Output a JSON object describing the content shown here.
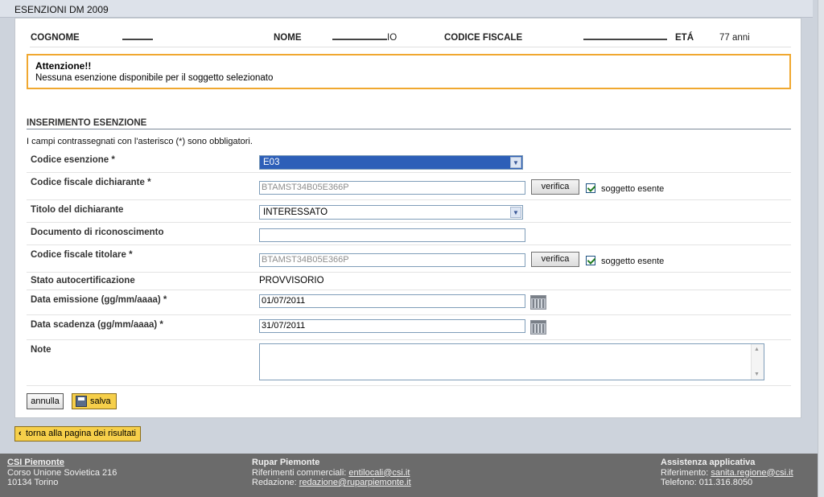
{
  "title": "ESENZIONI DM 2009",
  "patient": {
    "cognome_label": "COGNOME",
    "nome_label": "NOME",
    "nome_value_visible": "IO",
    "cf_label": "CODICE FISCALE",
    "eta_label": "ETÁ",
    "eta_value": "77 anni"
  },
  "alert": {
    "title": "Attenzione!!",
    "message": "Nessuna esenzione disponibile per il soggetto selezionato"
  },
  "section": {
    "title": "INSERIMENTO ESENZIONE",
    "required_note": "I campi contrassegnati con l'asterisco (*) sono obbligatori."
  },
  "form": {
    "codice_esenzione": {
      "label": "Codice esenzione *",
      "value": "E03"
    },
    "cf_dichiarante": {
      "label": "Codice fiscale dichiarante *",
      "value": "BTAMST34B05E366P",
      "button": "verifica",
      "checkbox_label": "soggetto esente",
      "checked": true
    },
    "titolo_dichiarante": {
      "label": "Titolo del dichiarante",
      "value": "INTERESSATO"
    },
    "documento": {
      "label": "Documento di riconoscimento",
      "value": ""
    },
    "cf_titolare": {
      "label": "Codice fiscale titolare *",
      "value": "BTAMST34B05E366P",
      "button": "verifica",
      "checkbox_label": "soggetto esente",
      "checked": true
    },
    "stato": {
      "label": "Stato autocertificazione",
      "value": "PROVVISORIO"
    },
    "data_emissione": {
      "label": "Data emissione (gg/mm/aaaa) *",
      "value": "01/07/2011"
    },
    "data_scadenza": {
      "label": "Data scadenza (gg/mm/aaaa) *",
      "value": "31/07/2011"
    },
    "note": {
      "label": "Note",
      "value": ""
    }
  },
  "buttons": {
    "annulla": "annulla",
    "salva": "salva",
    "back": "torna alla pagina dei risultati"
  },
  "footer": {
    "csi": {
      "title": "CSI Piemonte",
      "line1": "Corso Unione Sovietica 216",
      "line2": "10134 Torino"
    },
    "rupar": {
      "title": "Rupar Piemonte",
      "ref_label": "Riferimenti commerciali:",
      "ref_link": "entilocali@csi.it",
      "red_label": "Redazione:",
      "red_link": "redazione@ruparpiemonte.it"
    },
    "assistenza": {
      "title": "Assistenza applicativa",
      "ref_label": "Riferimento:",
      "ref_link": "sanita.regione@csi.it",
      "tel": "Telefono: 011.316.8050"
    }
  },
  "icons": [
    "chevron-down-icon",
    "calendar-icon",
    "save-disk-icon",
    "chevron-left-icon",
    "checkbox-checked-icon"
  ],
  "colors": {
    "alert_border": "#f0a830",
    "selected_option": "#2d5fb8",
    "action_button": "#f6cf4a",
    "footer": "#6b6b6b"
  }
}
